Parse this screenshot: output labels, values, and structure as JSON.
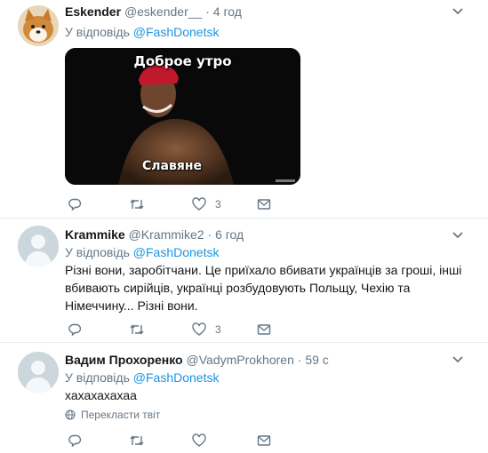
{
  "tweets": [
    {
      "name": "Eskender",
      "handle": "@eskender__",
      "separator": "·",
      "time": "4 год",
      "reply_prefix": "У відповідь ",
      "reply_mention": "@FashDonetsk",
      "avatar_icon": "shiba-dog-avatar",
      "media": {
        "caption_top": "Доброе утро",
        "caption_bottom": "Славяне"
      },
      "actions": {
        "reply": "",
        "retweet": "",
        "like": "3",
        "dm": ""
      }
    },
    {
      "name": "Krammike",
      "handle": "@Krammike2",
      "separator": "·",
      "time": "6 год",
      "reply_prefix": "У відповідь ",
      "reply_mention": "@FashDonetsk",
      "avatar_icon": "default-user-avatar",
      "text": "Різні вони, заробітчани. Це приїхало вбивати українців за гроші, інші вбивають сирійців, українці розбудовують Польщу, Чехію та Німеччину... Різні вони.",
      "actions": {
        "reply": "",
        "retweet": "",
        "like": "3",
        "dm": ""
      }
    },
    {
      "name": "Вадим Прохоренко",
      "handle": "@VadymProkhoren",
      "separator": "·",
      "time": "59 с",
      "reply_prefix": "У відповідь ",
      "reply_mention": "@FashDonetsk",
      "avatar_icon": "default-user-avatar",
      "text": "хахахахахаа",
      "translate": "Перекласти твіт",
      "actions": {
        "reply": "",
        "retweet": "",
        "like": "",
        "dm": ""
      }
    }
  ],
  "colors": {
    "link": "#1b95e0",
    "secondary": "#657786",
    "divider": "#e6ecf0",
    "avatar_default": "#ccd6dd"
  }
}
